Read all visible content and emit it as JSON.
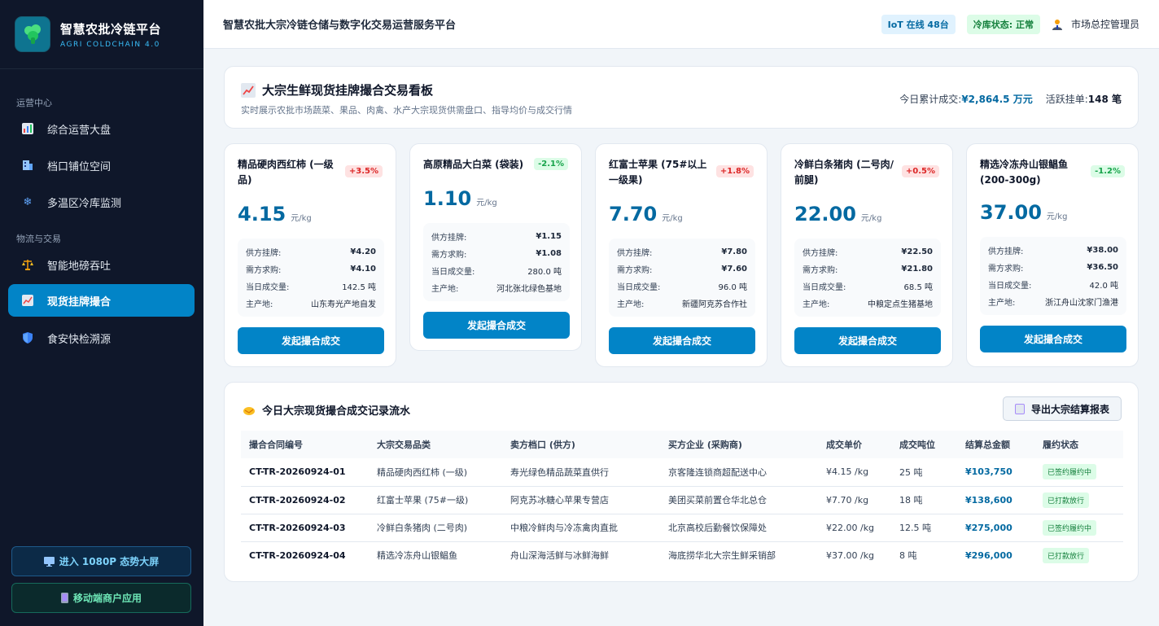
{
  "brand": {
    "title": "智慧农批冷链平台",
    "subtitle": "AGRI COLDCHAIN 4.0"
  },
  "nav": {
    "sections": [
      "运营中心",
      "物流与交易"
    ],
    "items": [
      {
        "label": "综合运营大盘",
        "icon": "bar-chart-icon"
      },
      {
        "label": "档口铺位空间",
        "icon": "building-icon"
      },
      {
        "label": "多温区冷库监测",
        "icon": "snowflake-icon"
      },
      {
        "label": "智能地磅吞吐",
        "icon": "scale-icon"
      },
      {
        "label": "现货挂牌撮合",
        "icon": "trend-chart-icon"
      },
      {
        "label": "食安快检溯源",
        "icon": "shield-icon"
      }
    ],
    "buttons": [
      "进入 1080P 态势大屏",
      "移动端商户应用"
    ]
  },
  "header": {
    "title": "智慧农批大宗冷链仓储与数字化交易运营服务平台",
    "iot_badge": "IoT 在线 48台",
    "cold_badge": "冷库状态: 正常",
    "user": "市场总控管理员"
  },
  "board": {
    "title": "大宗生鲜现货挂牌撮合交易看板",
    "subtitle": "实时展示农批市场蔬菜、果品、肉禽、水产大宗现货供需盘口、指导均价与成交行情",
    "turnover_label": "今日累计成交:",
    "turnover_value": "¥2,864.5 万元",
    "active_label": "活跃挂单:",
    "active_value": "148 笔"
  },
  "product_labels": {
    "supply": "供方挂牌:",
    "demand": "需方求购:",
    "volume": "当日成交量:",
    "origin": "主产地:",
    "button": "发起撮合成交"
  },
  "products": [
    {
      "name": "精品硬肉西红柿 (一级品)",
      "change": "+3.5%",
      "dir": "up",
      "price": "4.15",
      "unit": "元/kg",
      "supply": "¥4.20",
      "demand": "¥4.10",
      "volume": "142.5 吨",
      "origin": "山东寿光产地自发"
    },
    {
      "name": "高原精品大白菜 (袋装)",
      "change": "-2.1%",
      "dir": "down",
      "price": "1.10",
      "unit": "元/kg",
      "supply": "¥1.15",
      "demand": "¥1.08",
      "volume": "280.0 吨",
      "origin": "河北张北绿色基地"
    },
    {
      "name": "红富士苹果 (75#以上一级果)",
      "change": "+1.8%",
      "dir": "up",
      "price": "7.70",
      "unit": "元/kg",
      "supply": "¥7.80",
      "demand": "¥7.60",
      "volume": "96.0 吨",
      "origin": "新疆阿克苏合作社"
    },
    {
      "name": "冷鲜白条猪肉 (二号肉/前腿)",
      "change": "+0.5%",
      "dir": "up",
      "price": "22.00",
      "unit": "元/kg",
      "supply": "¥22.50",
      "demand": "¥21.80",
      "volume": "68.5 吨",
      "origin": "中粮定点生猪基地"
    },
    {
      "name": "精选冷冻舟山银鲳鱼 (200-300g)",
      "change": "-1.2%",
      "dir": "down",
      "price": "37.00",
      "unit": "元/kg",
      "supply": "¥38.00",
      "demand": "¥36.50",
      "volume": "42.0 吨",
      "origin": "浙江舟山沈家门渔港"
    }
  ],
  "records": {
    "title": "今日大宗现货撮合成交记录流水",
    "export_label": "导出大宗结算报表",
    "columns": [
      "撮合合同编号",
      "大宗交易品类",
      "卖方档口 (供方)",
      "买方企业 (采购商)",
      "成交单价",
      "成交吨位",
      "结算总金额",
      "履约状态"
    ],
    "rows": [
      {
        "id": "CT-TR-20260924-01",
        "category": "精品硬肉西红柿 (一级)",
        "seller": "寿光绿色精品蔬菜直供行",
        "buyer": "京客隆连锁商超配送中心",
        "price": "¥4.15 /kg",
        "tons": "25 吨",
        "amount": "¥103,750",
        "status": "已签约履约中"
      },
      {
        "id": "CT-TR-20260924-02",
        "category": "红富士苹果 (75#一级)",
        "seller": "阿克苏冰糖心苹果专营店",
        "buyer": "美团买菜前置仓华北总仓",
        "price": "¥7.70 /kg",
        "tons": "18 吨",
        "amount": "¥138,600",
        "status": "已打款放行"
      },
      {
        "id": "CT-TR-20260924-03",
        "category": "冷鲜白条猪肉 (二号肉)",
        "seller": "中粮冷鲜肉与冷冻禽肉直批",
        "buyer": "北京高校后勤餐饮保障处",
        "price": "¥22.00 /kg",
        "tons": "12.5 吨",
        "amount": "¥275,000",
        "status": "已签约履约中"
      },
      {
        "id": "CT-TR-20260924-04",
        "category": "精选冷冻舟山银鲳鱼",
        "seller": "舟山深海活鲜与冰鲜海鲜",
        "buyer": "海底捞华北大宗生鲜采销部",
        "price": "¥37.00 /kg",
        "tons": "8 吨",
        "amount": "¥296,000",
        "status": "已打款放行"
      }
    ]
  },
  "colors": {
    "accent": "#0284c7",
    "sidebar": "#0f172a",
    "up": "#dc2626",
    "down": "#16a34a"
  }
}
